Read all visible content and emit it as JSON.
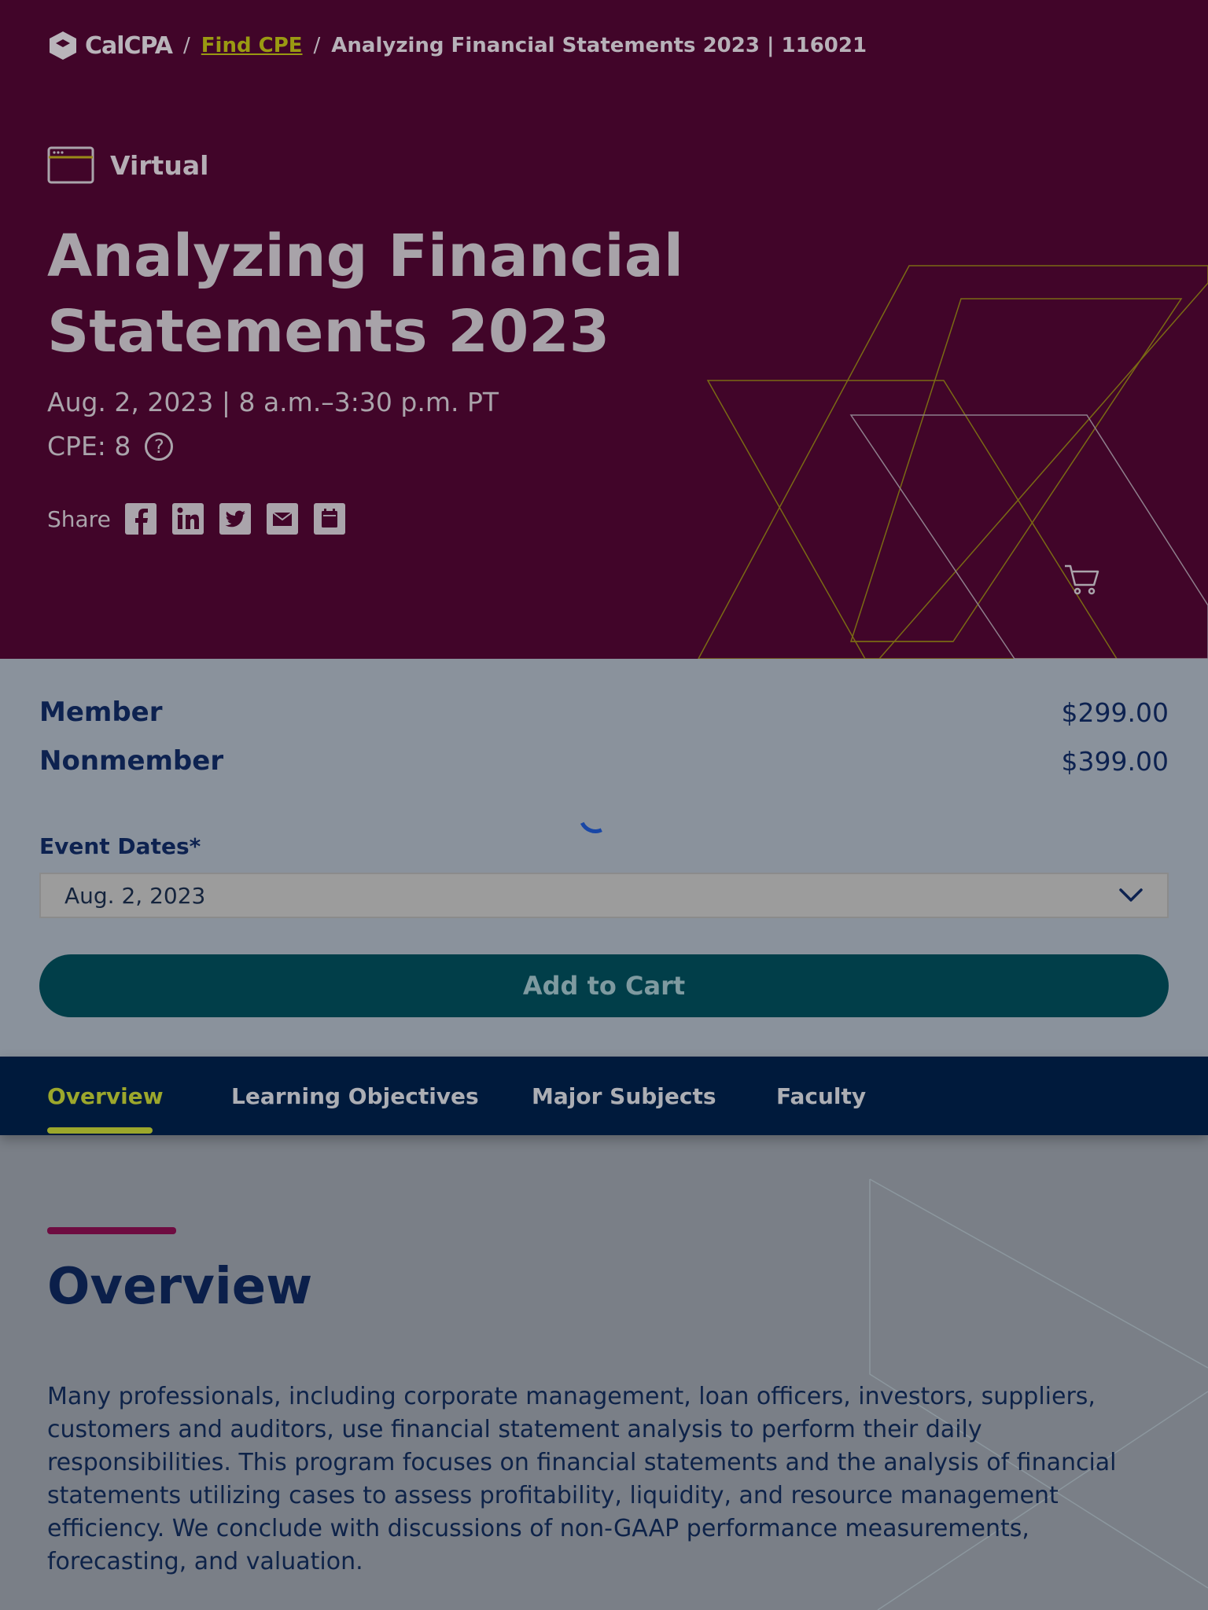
{
  "breadcrumb": {
    "logo_text": "CalCPA",
    "separator": "/",
    "link": "Find CPE",
    "current": "Analyzing Financial Statements 2023 | 116021"
  },
  "hero": {
    "format": "Virtual",
    "title": "Analyzing Financial Statements 2023",
    "date": "Aug. 2, 2023 | 8 a.m.–3:30 p.m. PT",
    "cpe": "CPE: 8",
    "help_glyph": "?",
    "share_label": "Share",
    "share_icons": [
      "facebook-icon",
      "linkedin-icon",
      "twitter-icon",
      "email-icon",
      "calendar-icon"
    ],
    "cart_icon": "cart-icon"
  },
  "pricing": {
    "member_label": "Member",
    "member_price": "$299.00",
    "nonmember_label": "Nonmember",
    "nonmember_price": "$399.00"
  },
  "event_dates": {
    "label": "Event Dates*",
    "selected": "Aug. 2, 2023"
  },
  "add_to_cart_label": "Add to Cart",
  "tabs": [
    {
      "label": "Overview",
      "active": true
    },
    {
      "label": "Learning Objectives",
      "active": false
    },
    {
      "label": "Major Subjects",
      "active": false
    },
    {
      "label": "Faculty",
      "active": false
    }
  ],
  "overview": {
    "heading": "Overview",
    "text": "Many professionals, including corporate management, loan officers, investors, suppliers, customers and auditors, use financial statement analysis to perform their daily responsibilities. This program focuses on financial statements and the analysis of financial statements utilizing cases to assess profitability, liquidity, and resource management efficiency. We conclude with discussions of non-GAAP performance measurements, forecasting, and valuation."
  },
  "colors": {
    "hero_bg": "#410529",
    "panel_bg": "#8a929c",
    "tab_bar_bg": "#001a3c",
    "accent_lime": "#9ca72c",
    "button_bg": "#013e49",
    "heading_navy": "#0b1f4a"
  }
}
